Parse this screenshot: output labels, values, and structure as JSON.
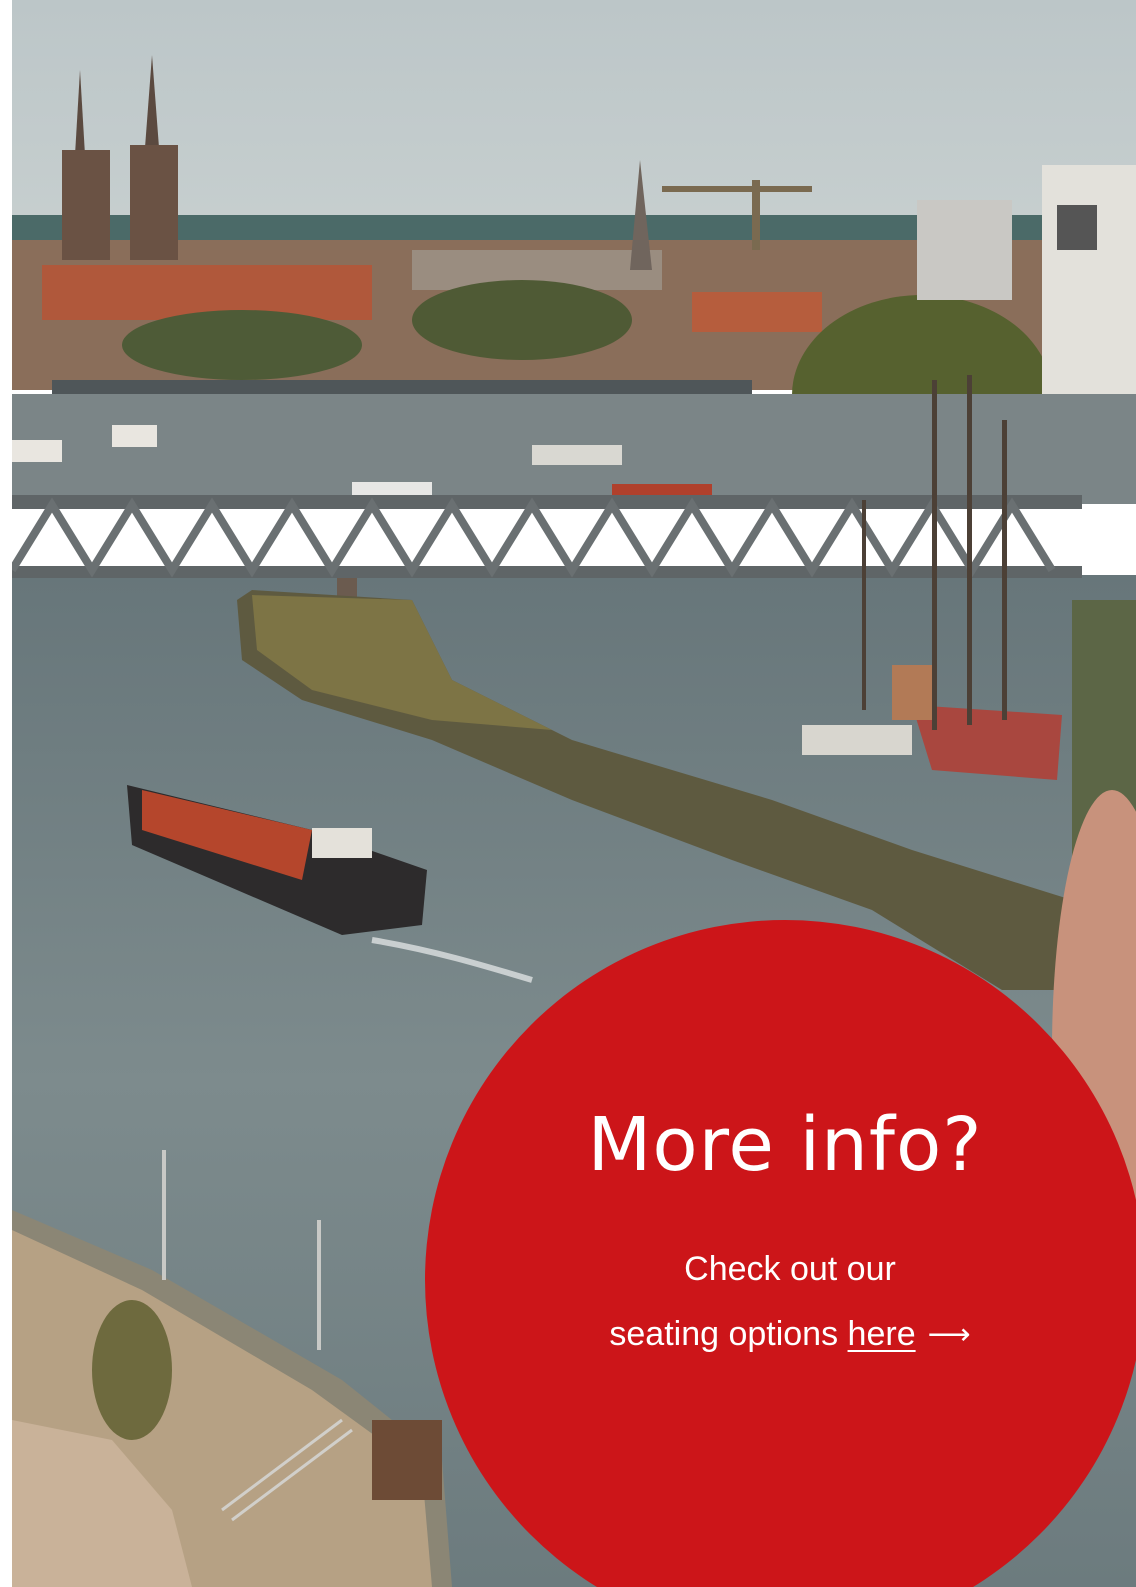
{
  "hero": {
    "image_description_name": "river-cityscape-photo"
  },
  "info": {
    "heading": "More info?",
    "line1": "Check out our",
    "line2_prefix": "seating options ",
    "link_label": "here",
    "arrow_glyph": "⟶",
    "arrow_icon": "arrow-right-icon"
  },
  "colors": {
    "accent_red": "#cc1519",
    "text_white": "#ffffff"
  }
}
